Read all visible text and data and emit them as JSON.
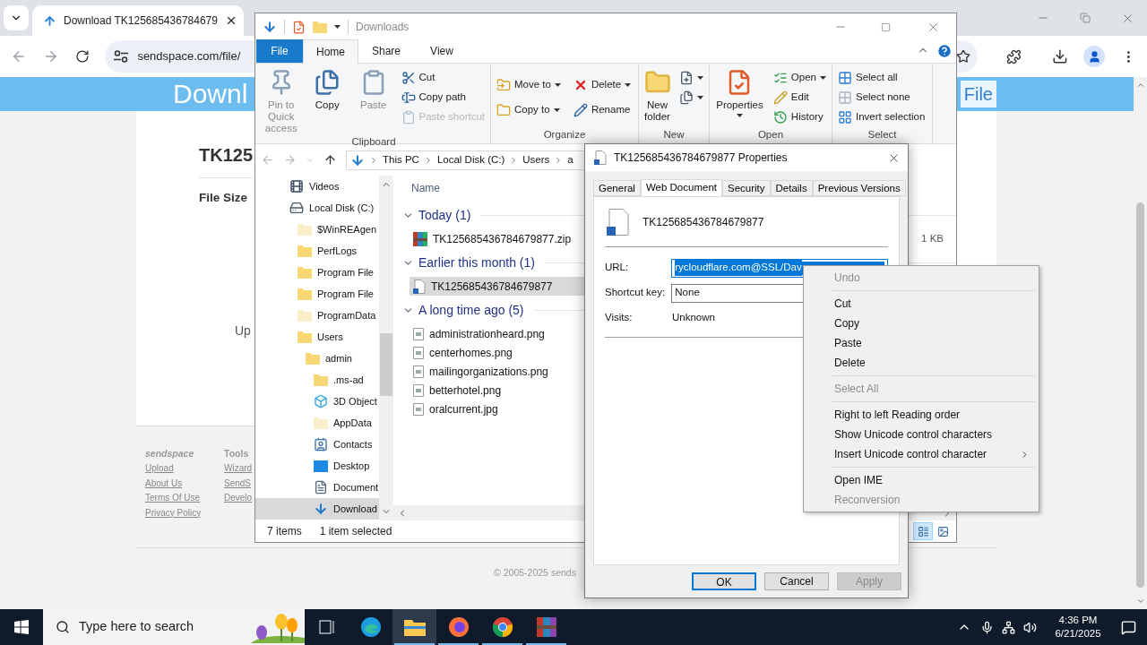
{
  "browser": {
    "tabs": [
      {
        "title": "Download TK125685436784679",
        "selected": true
      }
    ],
    "address": "sendspace.com/file/",
    "page": {
      "banner_title": "Downl",
      "banner_link": "File",
      "file_title": "TK125",
      "file_size_label": "File Size",
      "upgrade_text": "Up",
      "footer_columns": [
        {
          "heading": "sendspace",
          "links": [
            "Upload",
            "About Us",
            "Terms Of Use",
            "Privacy Policy"
          ]
        },
        {
          "heading": "Tools",
          "links": [
            "Wizard",
            "SendS",
            "Develo"
          ]
        }
      ],
      "copyright": "© 2005-2025 sends"
    }
  },
  "explorer": {
    "title": "Downloads",
    "ribbon_tabs": [
      {
        "label": "File",
        "selected": false
      },
      {
        "label": "Home",
        "selected": true
      },
      {
        "label": "Share",
        "selected": false
      },
      {
        "label": "View",
        "selected": false
      }
    ],
    "ribbon_groups": [
      {
        "name": "Clipboard",
        "large": [
          {
            "label": "Pin to Quick access",
            "kind": "pin",
            "disabled": true,
            "dropdown": false
          },
          {
            "label": "Copy",
            "kind": "copy",
            "disabled": false,
            "dropdown": false
          },
          {
            "label": "Paste",
            "kind": "paste",
            "disabled": true,
            "dropdown": false
          }
        ],
        "small": [
          {
            "label": "Cut",
            "kind": "cut",
            "disabled": false,
            "dropdown": false
          },
          {
            "label": "Copy path",
            "kind": "copy-path",
            "disabled": false,
            "dropdown": false
          },
          {
            "label": "Paste shortcut",
            "kind": "paste-shortcut",
            "disabled": true,
            "dropdown": false
          }
        ]
      },
      {
        "name": "Organize",
        "small": [
          {
            "label": "Move to",
            "kind": "move",
            "disabled": false,
            "dropdown": true
          },
          {
            "label": "Copy to",
            "kind": "copy-to",
            "disabled": false,
            "dropdown": true
          },
          {
            "label": "Delete",
            "kind": "delete",
            "disabled": false,
            "dropdown": true
          },
          {
            "label": "Rename",
            "kind": "rename",
            "disabled": false,
            "dropdown": false
          }
        ]
      },
      {
        "name": "New",
        "large": [
          {
            "label": "New folder",
            "kind": "new-folder",
            "disabled": false,
            "dropdown": false
          }
        ],
        "small": [
          {
            "kind": "new-item",
            "disabled": false,
            "dropdown": true
          },
          {
            "kind": "easy-access",
            "disabled": false,
            "dropdown": true
          }
        ]
      },
      {
        "name": "Open",
        "large": [
          {
            "label": "Properties",
            "kind": "properties",
            "disabled": false,
            "dropdown": true
          }
        ],
        "small": [
          {
            "label": "Open",
            "kind": "open",
            "disabled": false,
            "dropdown": true
          },
          {
            "label": "Edit",
            "kind": "edit",
            "disabled": false,
            "dropdown": false
          },
          {
            "label": "History",
            "kind": "history",
            "disabled": false,
            "dropdown": false
          }
        ]
      },
      {
        "name": "Select",
        "small": [
          {
            "label": "Select all",
            "kind": "select-all",
            "disabled": false,
            "dropdown": false
          },
          {
            "label": "Select none",
            "kind": "select-none",
            "disabled": false,
            "dropdown": false
          },
          {
            "label": "Invert selection",
            "kind": "invert",
            "disabled": false,
            "dropdown": false
          }
        ]
      }
    ],
    "breadcrumb": [
      "This PC",
      "Local Disk (C:)",
      "Users",
      "a"
    ],
    "nav": [
      {
        "label": "Videos",
        "kind": "videos",
        "selected": false
      },
      {
        "label": "Local Disk (C:)",
        "kind": "drive",
        "selected": false,
        "children": [
          {
            "label": "$WinREAgen",
            "kind": "hidden-folder",
            "selected": false
          },
          {
            "label": "PerfLogs",
            "kind": "folder",
            "selected": false
          },
          {
            "label": "Program File",
            "kind": "folder",
            "selected": false
          },
          {
            "label": "Program File",
            "kind": "folder",
            "selected": false
          },
          {
            "label": "ProgramData",
            "kind": "hidden-folder",
            "selected": false
          },
          {
            "label": "Users",
            "kind": "folder",
            "selected": false,
            "children": [
              {
                "label": "admin",
                "kind": "folder",
                "selected": false,
                "children": [
                  {
                    "label": ".ms-ad",
                    "kind": "folder",
                    "selected": false
                  },
                  {
                    "label": "3D Object",
                    "kind": "objects",
                    "selected": false
                  },
                  {
                    "label": "AppData",
                    "kind": "hidden-folder",
                    "selected": false
                  },
                  {
                    "label": "Contacts",
                    "kind": "contacts",
                    "selected": false
                  },
                  {
                    "label": "Desktop",
                    "kind": "desktop",
                    "selected": false
                  },
                  {
                    "label": "Document",
                    "kind": "documents",
                    "selected": false
                  },
                  {
                    "label": "Download",
                    "kind": "downloads",
                    "selected": true
                  }
                ]
              }
            ]
          }
        ]
      }
    ],
    "column_header": "Name",
    "groups": [
      {
        "label": "Today (1)",
        "expanded": true,
        "files": [
          {
            "name": "TK125685436784679877.zip",
            "kind": "archive",
            "selected": false,
            "size": "1 KB"
          }
        ]
      },
      {
        "label": "Earlier this month (1)",
        "expanded": true,
        "files": [
          {
            "name": "TK125685436784679877",
            "kind": "shortcut",
            "selected": true
          }
        ]
      },
      {
        "label": "A long time ago (5)",
        "expanded": true,
        "files": [
          {
            "name": "administrationheard.png",
            "kind": "image",
            "selected": false
          },
          {
            "name": "centerhomes.png",
            "kind": "image",
            "selected": false
          },
          {
            "name": "mailingorganizations.png",
            "kind": "image",
            "selected": false
          },
          {
            "name": "betterhotel.png",
            "kind": "image",
            "selected": false
          },
          {
            "name": "oralcurrent.jpg",
            "kind": "image",
            "selected": false
          }
        ]
      }
    ],
    "status": [
      "7 items",
      "1 item selected"
    ],
    "views": [
      {
        "kind": "details",
        "selected": true
      },
      {
        "kind": "large-icons",
        "selected": false
      }
    ]
  },
  "properties": {
    "title": "TK125685436784679877 Properties",
    "tabs": [
      {
        "label": "General",
        "selected": false
      },
      {
        "label": "Web Document",
        "selected": true
      },
      {
        "label": "Security",
        "selected": false
      },
      {
        "label": "Details",
        "selected": false
      },
      {
        "label": "Previous Versions",
        "selected": false
      }
    ],
    "file_name": "TK125685436784679877",
    "fields": [
      {
        "label": "URL:",
        "value": "rycloudflare.com@SSL/Dav",
        "kind": "input",
        "highlighted": true
      },
      {
        "label": "Shortcut key:",
        "value": "None",
        "kind": "input",
        "highlighted": false
      },
      {
        "label": "Visits:",
        "value": "Unknown",
        "kind": "text"
      }
    ],
    "buttons": [
      {
        "label": "OK",
        "default": true,
        "disabled": false
      },
      {
        "label": "Cancel",
        "default": false,
        "disabled": false
      },
      {
        "label": "Apply",
        "default": false,
        "disabled": true
      }
    ]
  },
  "context_menu": {
    "sections": [
      [
        {
          "label": "Undo",
          "disabled": true,
          "submenu": false
        }
      ],
      [
        {
          "label": "Cut",
          "disabled": false,
          "submenu": false
        },
        {
          "label": "Copy",
          "disabled": false,
          "submenu": false
        },
        {
          "label": "Paste",
          "disabled": false,
          "submenu": false
        },
        {
          "label": "Delete",
          "disabled": false,
          "submenu": false
        }
      ],
      [
        {
          "label": "Select All",
          "disabled": true,
          "submenu": false
        }
      ],
      [
        {
          "label": "Right to left Reading order",
          "disabled": false,
          "submenu": false
        },
        {
          "label": "Show Unicode control characters",
          "disabled": false,
          "submenu": false
        },
        {
          "label": "Insert Unicode control character",
          "disabled": false,
          "submenu": true
        }
      ],
      [
        {
          "label": "Open IME",
          "disabled": false,
          "submenu": false
        },
        {
          "label": "Reconversion",
          "disabled": true,
          "submenu": false
        }
      ]
    ]
  },
  "taskbar": {
    "search_placeholder": "Type here to search",
    "apps": [
      {
        "kind": "task-view",
        "running": false,
        "active": false
      },
      {
        "kind": "edge",
        "running": false,
        "active": false
      },
      {
        "kind": "explorer",
        "running": true,
        "active": true
      },
      {
        "kind": "firefox",
        "running": true,
        "active": false
      },
      {
        "kind": "chrome",
        "running": true,
        "active": false
      },
      {
        "kind": "winrar",
        "running": true,
        "active": false
      }
    ],
    "time": "4:36 PM",
    "date": "6/21/2025"
  }
}
